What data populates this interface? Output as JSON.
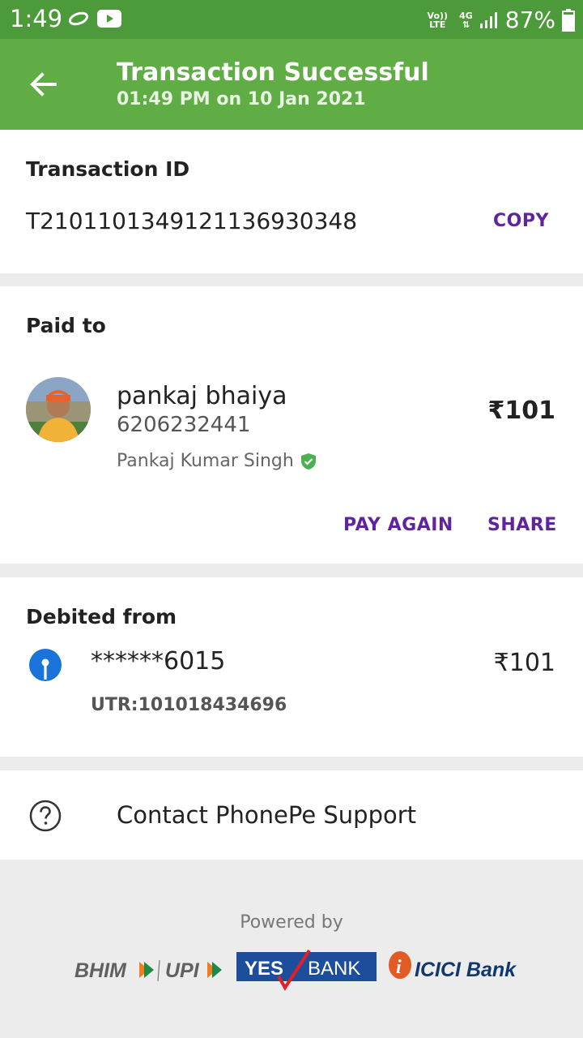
{
  "status_bar": {
    "time": "1:49",
    "volte_line1": "Vo))",
    "volte_line2": "LTE",
    "network": "4G",
    "battery": "87%"
  },
  "header": {
    "title": "Transaction Successful",
    "subtitle": "01:49 PM on 10 Jan 2021",
    "background": "#60ad45"
  },
  "transaction": {
    "label": "Transaction ID",
    "id": "T2101101349121136930348",
    "copy_label": "COPY"
  },
  "paid_to": {
    "label": "Paid to",
    "name": "pankaj bhaiya",
    "phone": "6206232441",
    "verified_name": "Pankaj Kumar Singh",
    "amount": "₹101",
    "pay_again_label": "PAY AGAIN",
    "share_label": "SHARE"
  },
  "debited_from": {
    "label": "Debited from",
    "account": "******6015",
    "amount": "₹101",
    "utr": "UTR:101018434696"
  },
  "support": {
    "label": "Contact PhonePe Support"
  },
  "footer": {
    "powered_by": "Powered by",
    "bhim_text": "BHIM",
    "upi_text": "UPI",
    "yes_bank_text_1": "YES",
    "yes_bank_text_2": "BANK",
    "icici_text": "ICICI Bank"
  },
  "colors": {
    "accent_purple": "#5f259f",
    "status_green": "#4c9a3a"
  }
}
